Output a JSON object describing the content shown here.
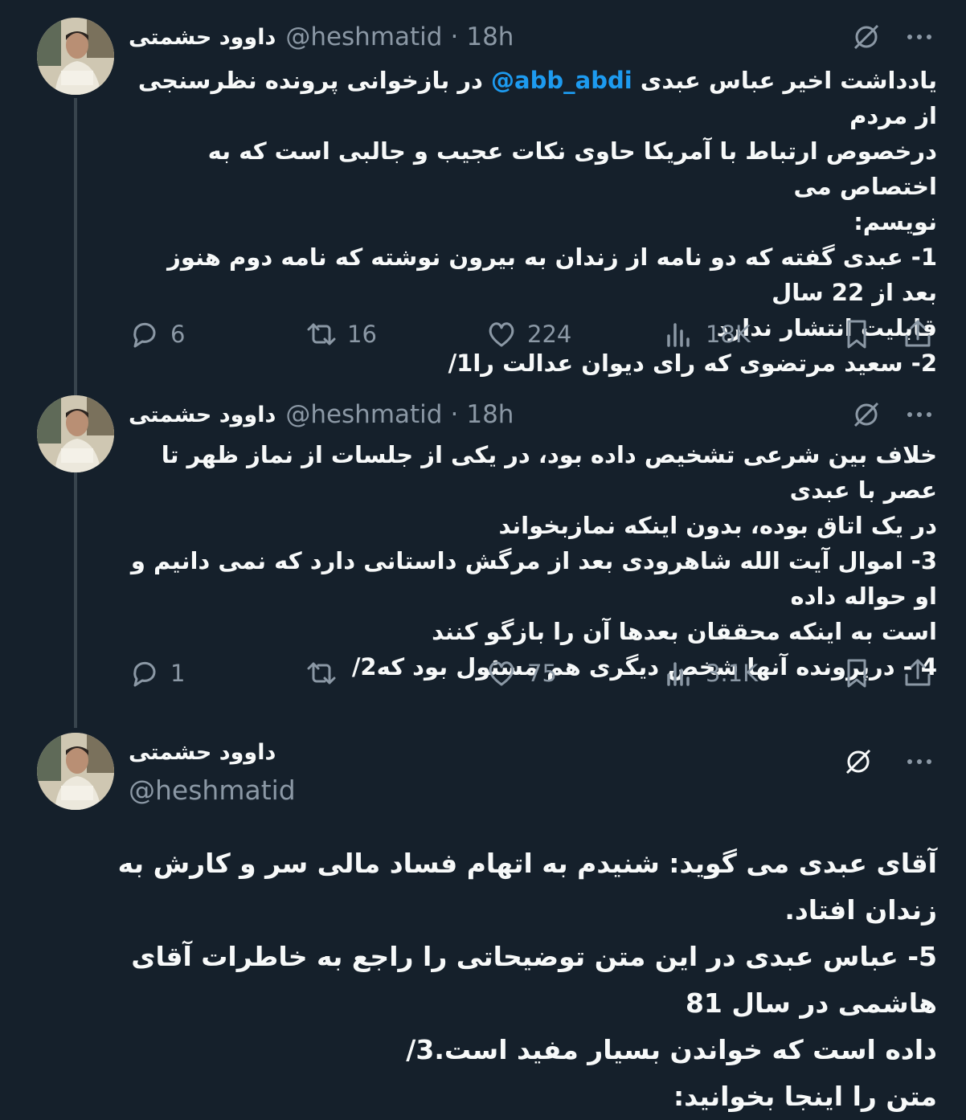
{
  "tweets": [
    {
      "name": "داوود حشمتی",
      "handle": "@heshmatid",
      "time": "18h",
      "lines": [
        {
          "pre": "یادداشت اخیر عباس عبدی ",
          "mention": "@abb_abdi",
          "post": " در بازخوانی پرونده نظرسنجی از مردم"
        },
        {
          "text": "درخصوص ارتباط با آمریکا حاوی نکات عجیب و جالبی است که به اختصاص می"
        },
        {
          "text": "نویسم:"
        },
        {
          "text": "1- عبدی گفته که دو نامه از زندان به بیرون نوشته که نامه دوم هنوز بعد از 22 سال"
        },
        {
          "text": "قابلیت انتشار ندارد"
        },
        {
          "text": "2- سعید مرتضوی که رای دیوان عدالت را1/"
        }
      ],
      "stats": {
        "replies": "6",
        "retweets": "16",
        "likes": "224",
        "views": "18K"
      }
    },
    {
      "name": "داوود حشمتی",
      "handle": "@heshmatid",
      "time": "18h",
      "lines": [
        {
          "text": "خلاف بین شرعی تشخیص داده بود، در یکی از جلسات از نماز ظهر تا عصر با عبدی"
        },
        {
          "text": "در یک اتاق بوده، بدون اینکه نمازبخواند"
        },
        {
          "text": "3- اموال آیت الله شاهرودی بعد از مرگش داستانی دارد که نمی دانیم و او حواله داده"
        },
        {
          "text": "است به اینکه محققان بعدها آن را بازگو کنند"
        },
        {
          "text": "4 - درپرونده آنها شخص دیگری هم مسئول بود که2/"
        }
      ],
      "stats": {
        "replies": "1",
        "retweets": "",
        "likes": "75",
        "views": "3.1K"
      }
    },
    {
      "name": "داوود حشمتی",
      "handle": "@heshmatid",
      "lines": [
        {
          "text": "آقای عبدی می گوید: شنیدم به اتهام فساد مالی سر و کارش به زندان افتاد."
        },
        {
          "text": "5- عباس عبدی در این متن توضیحاتی را راجع به خاطرات آقای هاشمی در سال 81"
        },
        {
          "text": "داده است که خواندن بسیار مفید است.3/"
        },
        {
          "text": "متن را اینجا بخوانید:"
        }
      ]
    }
  ],
  "icons": {
    "grok": "grok-icon",
    "more": "more-icon",
    "reply": "reply-icon",
    "retweet": "retweet-icon",
    "like": "like-icon",
    "views": "views-icon",
    "bookmark": "bookmark-icon",
    "share": "share-icon"
  },
  "colors": {
    "background": "#15202b",
    "text": "#f7f9f9",
    "muted": "#8b98a5",
    "mention": "#1d9bf0",
    "thread_line": "#38444d"
  }
}
